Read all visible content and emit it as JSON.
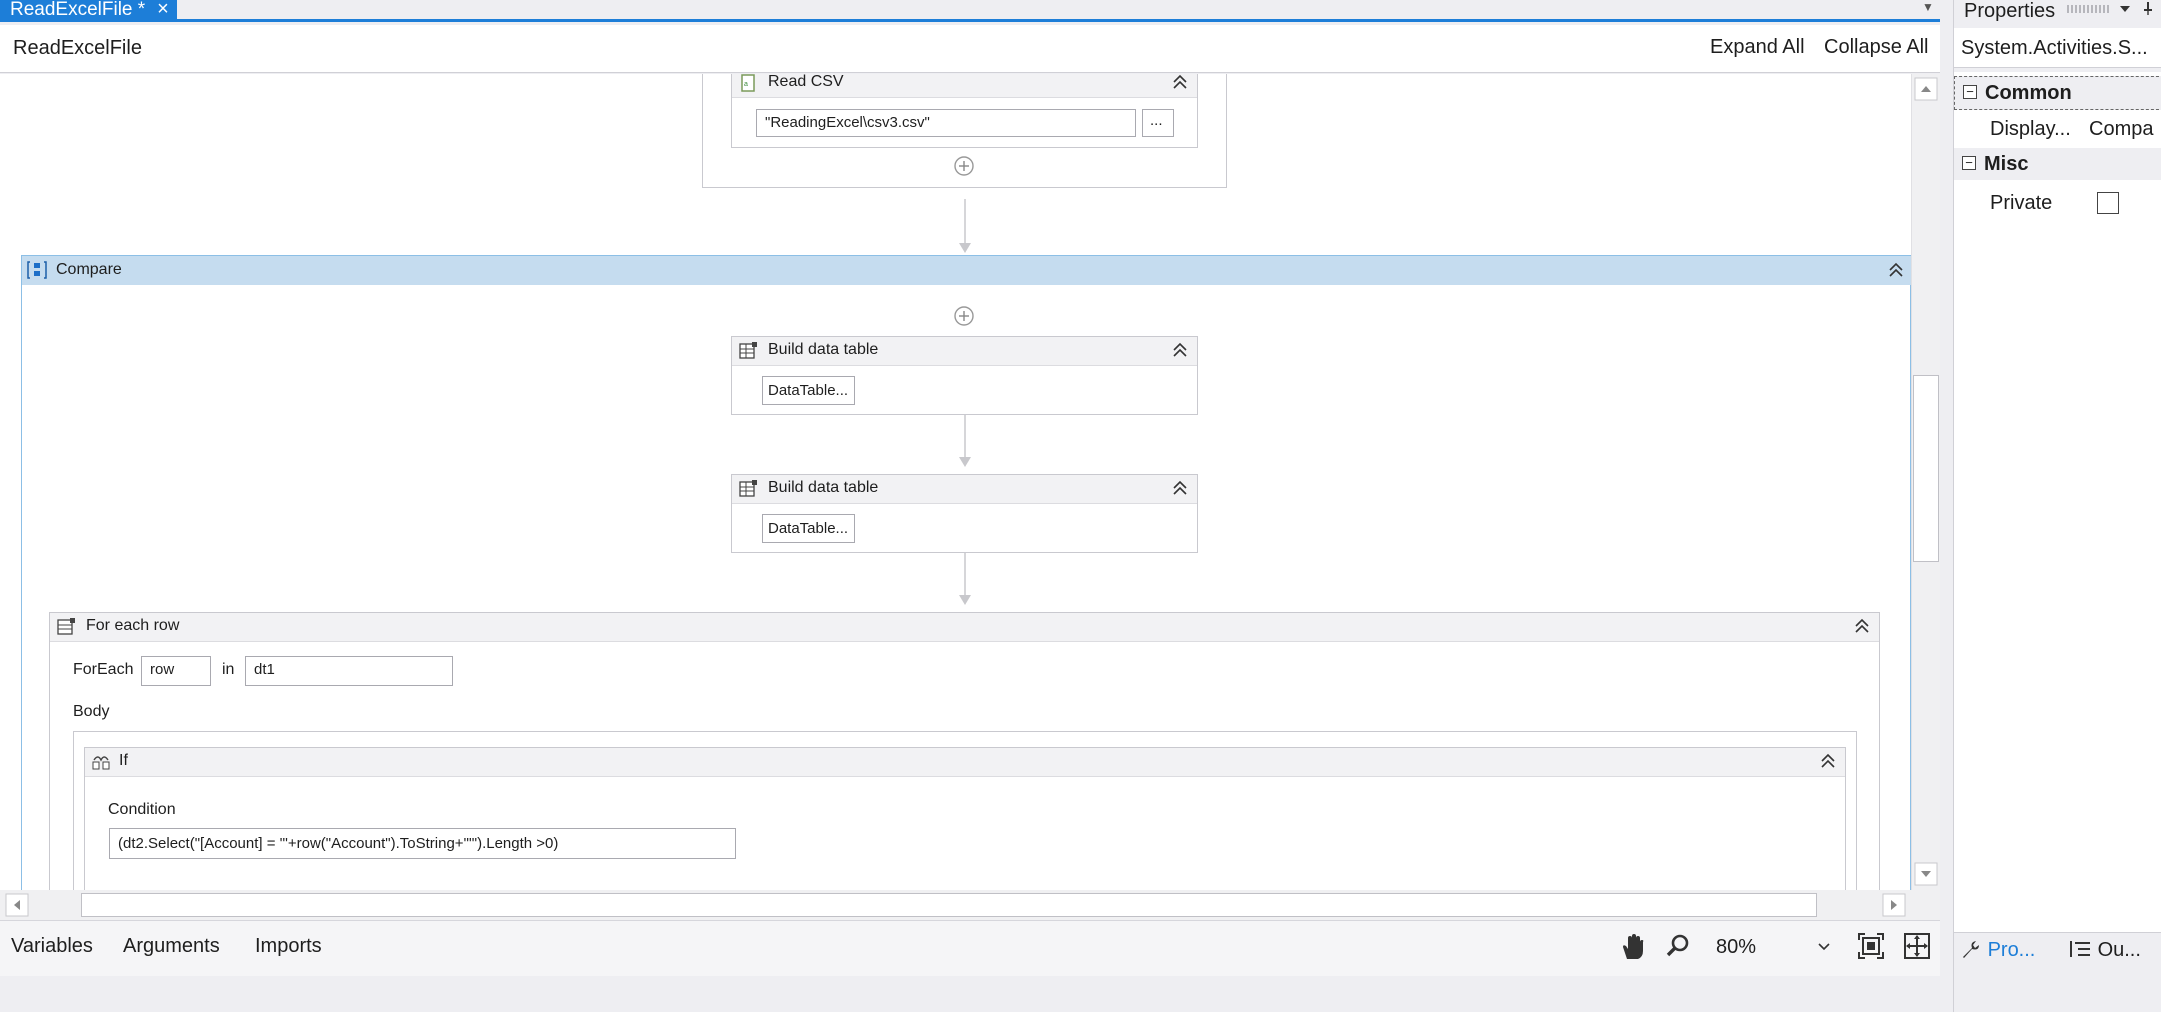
{
  "document_tab": {
    "title": "ReadExcelFile *",
    "close_glyph": "×"
  },
  "designer": {
    "title": "ReadExcelFile",
    "expand_all": "Expand All",
    "collapse_all": "Collapse All"
  },
  "read_csv": {
    "title": "Read CSV",
    "path_value": "\"ReadingExcel\\csv3.csv\"",
    "browse_label": "..."
  },
  "compare": {
    "title": "Compare"
  },
  "build_table_1": {
    "title": "Build data table",
    "button": "DataTable..."
  },
  "build_table_2": {
    "title": "Build data table",
    "button": "DataTable..."
  },
  "for_each": {
    "title": "For each row",
    "foreach_label": "ForEach",
    "item_value": "row",
    "in_label": "in",
    "collection_value": "dt1",
    "body_label": "Body"
  },
  "if_activity": {
    "title": "If",
    "condition_label": "Condition",
    "condition_value": "(dt2.Select(\"[Account] = '\"+row(\"Account\").ToString+\"'\").Length >0)"
  },
  "bottom_bar": {
    "variables": "Variables",
    "arguments": "Arguments",
    "imports": "Imports",
    "zoom": "80%"
  },
  "properties": {
    "title": "Properties",
    "type_name": "System.Activities.S...",
    "categories": [
      {
        "name": "Common",
        "items": [
          {
            "name": "Display...",
            "value": "Compa"
          }
        ]
      },
      {
        "name": "Misc",
        "items": [
          {
            "name": "Private",
            "value": ""
          }
        ]
      }
    ],
    "tabs": [
      {
        "label": "Pro..."
      },
      {
        "label": "Ou..."
      }
    ]
  },
  "icons": [
    "close-icon",
    "collapse-icon",
    "add-activity-icon",
    "sequence-icon",
    "data-table-icon",
    "loop-icon",
    "if-icon",
    "hand-pan-icon",
    "zoom-search-icon",
    "fit-to-screen-icon",
    "overview-icon",
    "wrench-icon",
    "outline-icon",
    "pin-icon",
    "chevron-down-icon"
  ],
  "colors": {
    "accent": "#1d7ed8",
    "selected_header": "#c5dcef"
  }
}
